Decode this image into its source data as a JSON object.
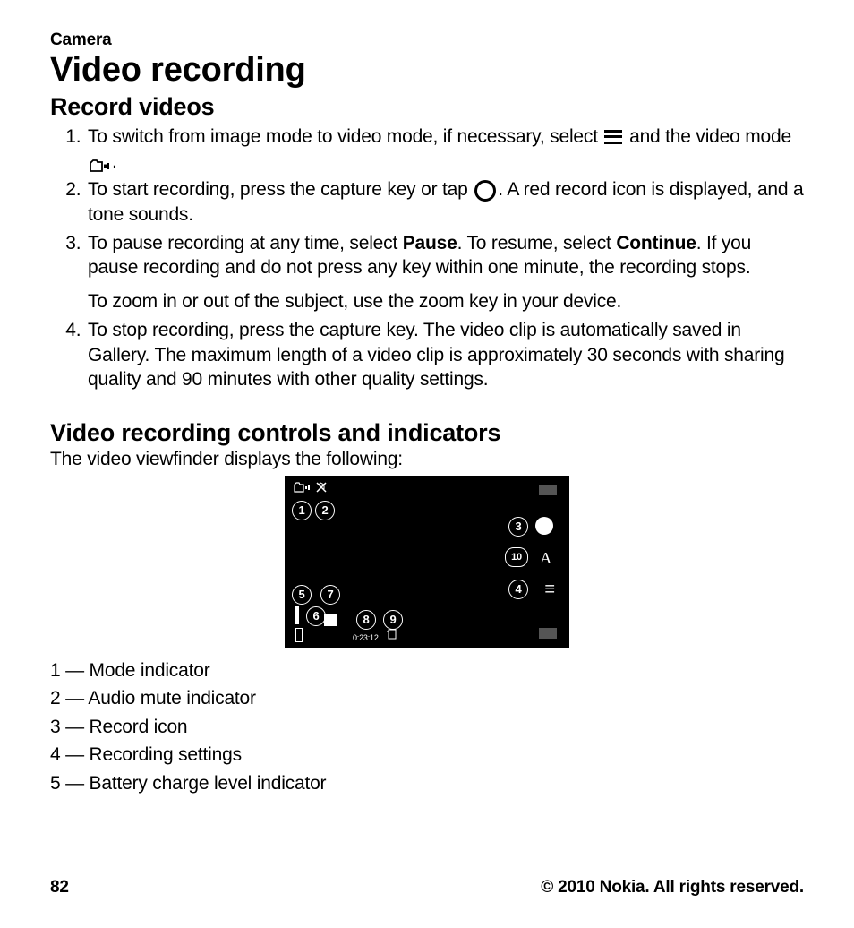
{
  "header": "Camera",
  "h1": "Video recording",
  "h2a": "Record videos",
  "step1a": "To switch from image mode to video mode, if necessary, select ",
  "step1b": " and the video mode ",
  "step1c": ".",
  "step2a": "To start recording, press the capture key or tap ",
  "step2b": ". A red record icon is displayed, and a tone sounds.",
  "step3a": "To pause recording at any time, select ",
  "pause": "Pause",
  "step3b": ". To resume, select ",
  "continue": "Continue",
  "step3c": ". If you pause recording and do not press any key within one minute, the recording stops.",
  "step3d": "To zoom in or out of the subject, use the zoom key in your device.",
  "step4": "To stop recording, press the capture key. The video clip is automatically saved in Gallery. The maximum length of a video clip is approximately 30 seconds with sharing quality and 90 minutes with other quality settings.",
  "h2b": "Video recording controls and indicators",
  "intro": "The video viewfinder displays the following:",
  "vf_time": "0:23:12",
  "legend": {
    "l1": "1 — Mode indicator",
    "l2": "2 — Audio mute indicator",
    "l3": "3 — Record icon",
    "l4": "4 — Recording settings",
    "l5": "5 — Battery charge level indicator"
  },
  "page": "82",
  "copyright": "© 2010 Nokia. All rights reserved."
}
